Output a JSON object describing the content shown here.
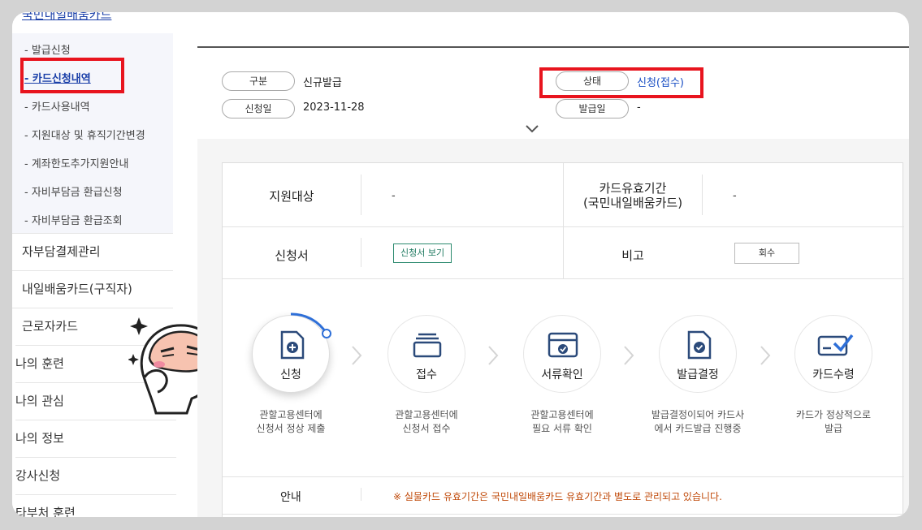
{
  "sidebar": {
    "section_title": "국민내일배움카드",
    "sub_items": [
      {
        "label": "- 발급신청",
        "active": false
      },
      {
        "label": "- 카드신청내역",
        "active": true
      },
      {
        "label": "- 카드사용내역",
        "active": false
      },
      {
        "label": "- 지원대상 및 휴직기간변경",
        "active": false
      },
      {
        "label": "- 계좌한도추가지원안내",
        "active": false
      },
      {
        "label": "- 자비부담금 환급신청",
        "active": false
      },
      {
        "label": "- 자비부담금 환급조회",
        "active": false
      }
    ],
    "main_items": [
      {
        "label": "자부담결제관리"
      },
      {
        "label": "내일배움카드(구직자)"
      },
      {
        "label": "근로자카드"
      },
      {
        "label": "나의 훈련"
      },
      {
        "label": "나의 관심"
      },
      {
        "label": "나의 정보"
      },
      {
        "label": "강사신청"
      },
      {
        "label": "타부처 훈련"
      }
    ]
  },
  "summary": {
    "type_label": "구분",
    "type_value": "신규발급",
    "apply_date_label": "신청일",
    "apply_date_value": "2023-11-28",
    "status_label": "상태",
    "status_value": "신청(접수)",
    "issue_date_label": "발급일",
    "issue_date_value": "-"
  },
  "detail": {
    "support_target_label": "지원대상",
    "support_target_value": "-",
    "card_validity_label_line1": "카드유효기간",
    "card_validity_label_line2": "(국민내일배움카드)",
    "card_validity_value": "-",
    "application_label": "신청서",
    "view_application_button": "신청서 보기",
    "remarks_label": "비고",
    "withdraw_button": "회수"
  },
  "steps": [
    {
      "label": "신청",
      "desc_line1": "관할고용센터에",
      "desc_line2": "신청서 정상 제출",
      "icon": "document-plus-icon",
      "active": true
    },
    {
      "label": "접수",
      "desc_line1": "관할고용센터에",
      "desc_line2": "신청서 접수",
      "icon": "tray-icon",
      "active": false
    },
    {
      "label": "서류확인",
      "desc_line1": "관할고용센터에",
      "desc_line2": "필요 서류 확인",
      "icon": "folder-check-icon",
      "active": false
    },
    {
      "label": "발급결정",
      "desc_line1": "발급결정이되어 카드사",
      "desc_line2": "에서 카드발급 진행중",
      "icon": "document-check-icon",
      "active": false
    },
    {
      "label": "카드수령",
      "desc_line1": "카드가 정상적으로",
      "desc_line2": "발급",
      "icon": "card-check-icon",
      "active": false
    }
  ],
  "notice": {
    "label": "안내",
    "text": "※ 실물카드 유효기간은 국민내일배움카드 유효기간과 별도로 관리되고 있습니다."
  },
  "colors": {
    "highlight_box": "#e8141e",
    "accent_blue": "#1a4fc4",
    "notice_orange": "#c04a0a",
    "button_green": "#1f7a60"
  }
}
